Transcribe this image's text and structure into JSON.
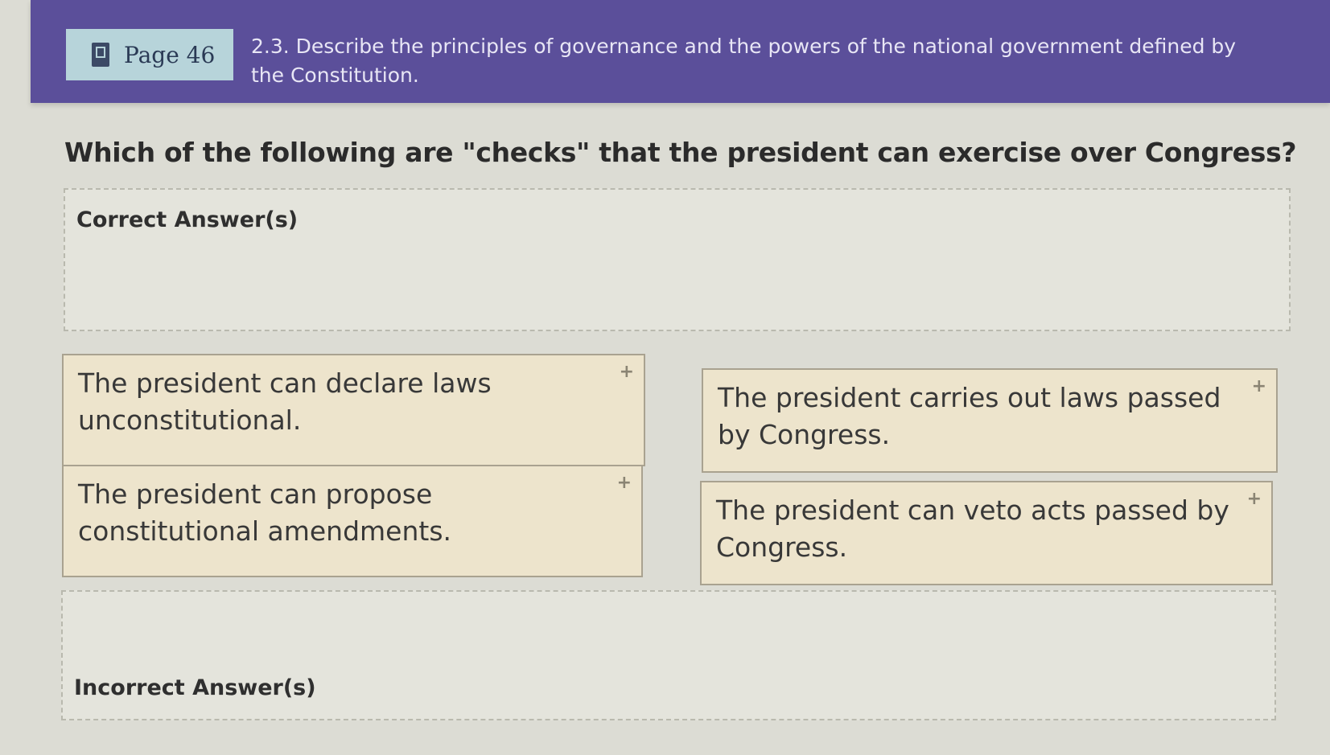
{
  "header": {
    "page_tab_label": "Page 46",
    "objective": "2.3. Describe the principles of governance and the powers of the national government defined by the Constitution.",
    "page_icon": "book-icon"
  },
  "question": "Which of the following are \"checks\" that the president can exercise over Congress?",
  "zones": {
    "correct_title": "Correct Answer(s)",
    "incorrect_title": "Incorrect Answer(s)"
  },
  "options": [
    "The president can declare laws unconstitutional.",
    "The president carries out laws passed by Congress.",
    "The president can propose constitutional amendments.",
    "The president can veto acts passed by Congress."
  ],
  "option_icon": "plus-icon",
  "option_marker": "+",
  "colors": {
    "header": "#5b4f9a",
    "page_tab": "#b7d4da",
    "option_bg": "#ede4cc",
    "background": "#dcdcd4"
  }
}
